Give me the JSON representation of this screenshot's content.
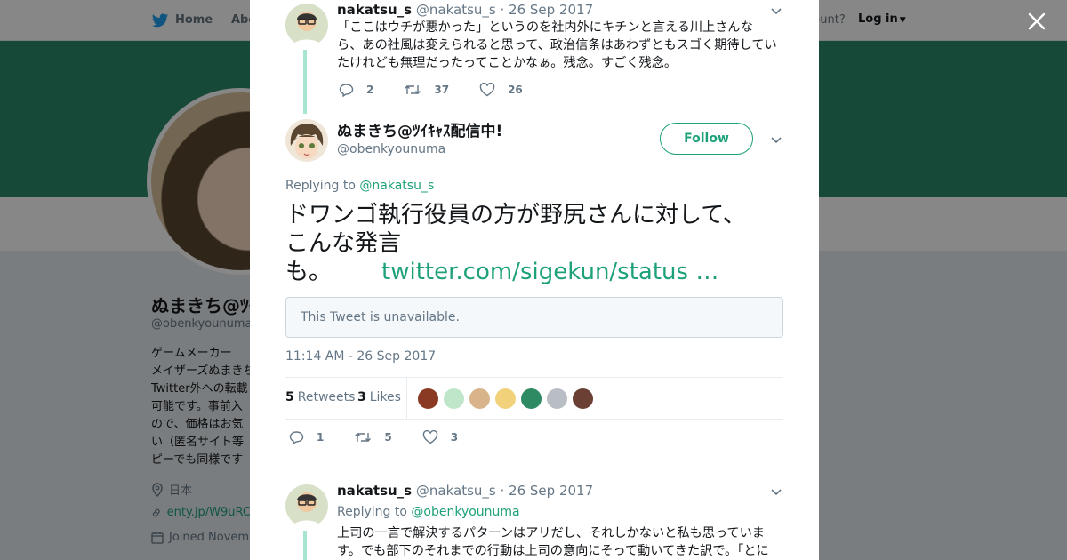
{
  "top_nav": {
    "home_label": "Home",
    "about_label": "Abo",
    "account_text": "ccount?",
    "login_label": "Log in"
  },
  "profile": {
    "name": "ぬまきち@ﾂｲｷｬｽ配信中!",
    "handle": "@obenkyounuma",
    "bio_lines": [
      "ゲームメーカー",
      "メイザーズぬまきち",
      "Twitter外への転載",
      "可能です。事前入",
      "ので、価格はお気",
      "い（匿名サイト等",
      "ピーでも同様です"
    ],
    "location": "日本",
    "link": "enty.jp/W9uRC",
    "joined": "Joined Novem"
  },
  "colors": {
    "banner": "#2a8a6a",
    "accent": "#1da17a",
    "thread_line": "#a6e5d2"
  },
  "modal": {
    "prev_tweet": {
      "name": "nakatsu_s",
      "handle": "@nakatsu_s",
      "date": "· 26 Sep 2017",
      "text": "「ここはウチが悪かった」というのを社内外にキチンと言える川上さんなら、あの社風は変えられると思って、政治信条はあわずともスゴく期待していたけれども無理だったってことかなぁ。残念。すごく残念。",
      "replies": "2",
      "retweets": "37",
      "likes": "26"
    },
    "main_tweet": {
      "name": "ぬまきち@ﾂｲｷｬｽ配信中!",
      "handle": "@obenkyounuma",
      "follow_label": "Follow",
      "replying_label": "Replying to",
      "replying_handle": "@nakatsu_s",
      "text_line1": "ドワンゴ執行役員の方が野尻さんに対して、",
      "text_line2": "こんな発言",
      "text_line3": "も。",
      "link_text": "twitter.com/sigekun/status …",
      "unavailable_text": "This Tweet is unavailable.",
      "timestamp": "11:14 AM - 26 Sep 2017",
      "retweet_count": "5",
      "retweet_label": "Retweets",
      "like_count": "3",
      "like_label": "Likes",
      "replies": "1",
      "retweets": "5",
      "likes": "3"
    },
    "reply_tweet": {
      "name": "nakatsu_s",
      "handle": "@nakatsu_s",
      "date": "· 26 Sep 2017",
      "replying_label": "Replying to",
      "replying_handle": "@obenkyounuma",
      "text_line1": "上司の一言で解決するパターンはアリだし、それしかないと私も思っていま",
      "text_line2": "す。でも部下のそれまでの行動は上司の意向にそって動いてきた訳で。「とに"
    }
  }
}
